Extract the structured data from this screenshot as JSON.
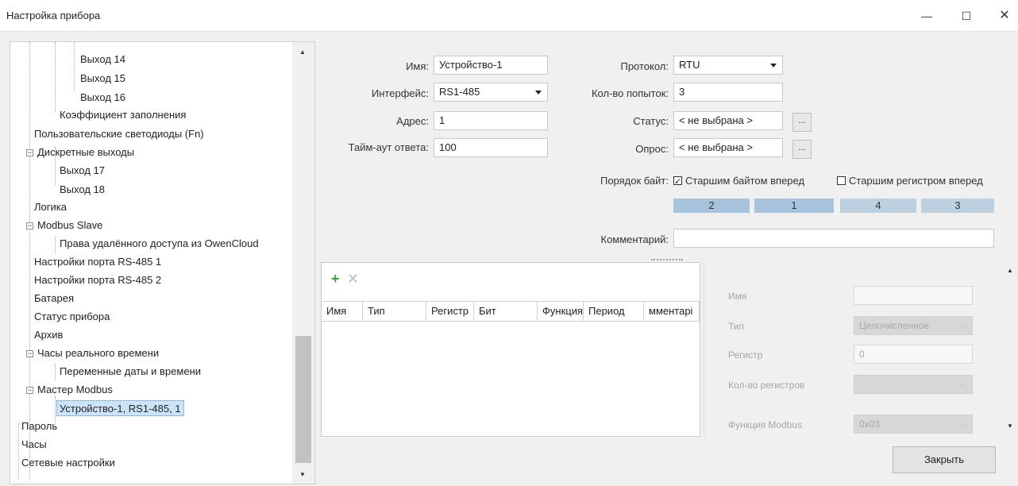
{
  "window": {
    "title": "Настройка прибора",
    "min": "—",
    "max": "☐",
    "close": "✕"
  },
  "tree": [
    {
      "label": "Выход 14"
    },
    {
      "label": "Выход 15"
    },
    {
      "label": "Выход 16"
    },
    {
      "label": "Коэффициент заполнения"
    },
    {
      "label": "Пользовательские светодиоды (Fn)"
    },
    {
      "label": "Дискретные выходы"
    },
    {
      "label": "Выход 17"
    },
    {
      "label": "Выход 18"
    },
    {
      "label": "Логика"
    },
    {
      "label": "Modbus Slave"
    },
    {
      "label": "Права удалённого доступа из OwenCloud"
    },
    {
      "label": "Настройки порта RS-485 1"
    },
    {
      "label": "Настройки порта RS-485 2"
    },
    {
      "label": "Батарея"
    },
    {
      "label": "Статус прибора"
    },
    {
      "label": "Архив"
    },
    {
      "label": "Часы реального времени"
    },
    {
      "label": "Переменные даты и времени"
    },
    {
      "label": "Мастер Modbus"
    },
    {
      "label": "Устройство-1, RS1-485, 1"
    },
    {
      "label": "Пароль"
    },
    {
      "label": "Часы"
    },
    {
      "label": "Сетевые настройки"
    }
  ],
  "form": {
    "name_label": "Имя:",
    "name_value": "Устройство-1",
    "interface_label": "Интерфейс:",
    "interface_value": "RS1-485",
    "address_label": "Адрес:",
    "address_value": "1",
    "timeout_label": "Тайм-аут ответа:",
    "timeout_value": "100",
    "protocol_label": "Протокол:",
    "protocol_value": "RTU",
    "retries_label": "Кол-во попыток:",
    "retries_value": "3",
    "status_label": "Статус:",
    "status_value": "< не выбрана >",
    "poll_label": "Опрос:",
    "poll_value": "< не выбрана >",
    "browse": "...",
    "byte_order_label": "Порядок байт:",
    "high_byte_first": "Старшим байтом вперед",
    "high_reg_first": "Старшим регистром вперед",
    "byte_cells": [
      "2",
      "1",
      "4",
      "3"
    ],
    "comment_label": "Комментарий:",
    "comment_value": ""
  },
  "grid": {
    "add": "+",
    "delete": "✕",
    "columns": [
      "Имя",
      "Тип",
      "Регистр",
      "Бит",
      "Функция",
      "Период",
      "мментарі"
    ]
  },
  "props": {
    "name_label": "Имя",
    "name_value": "",
    "type_label": "Тип",
    "type_value": "Целочисленное",
    "register_label": "Регистр",
    "register_value": "0",
    "reg_count_label": "Кол-во регистров",
    "reg_count_value": "",
    "function_label": "Функция Modbus",
    "function_value": "0x03"
  },
  "footer": {
    "close_label": "Закрыть"
  }
}
